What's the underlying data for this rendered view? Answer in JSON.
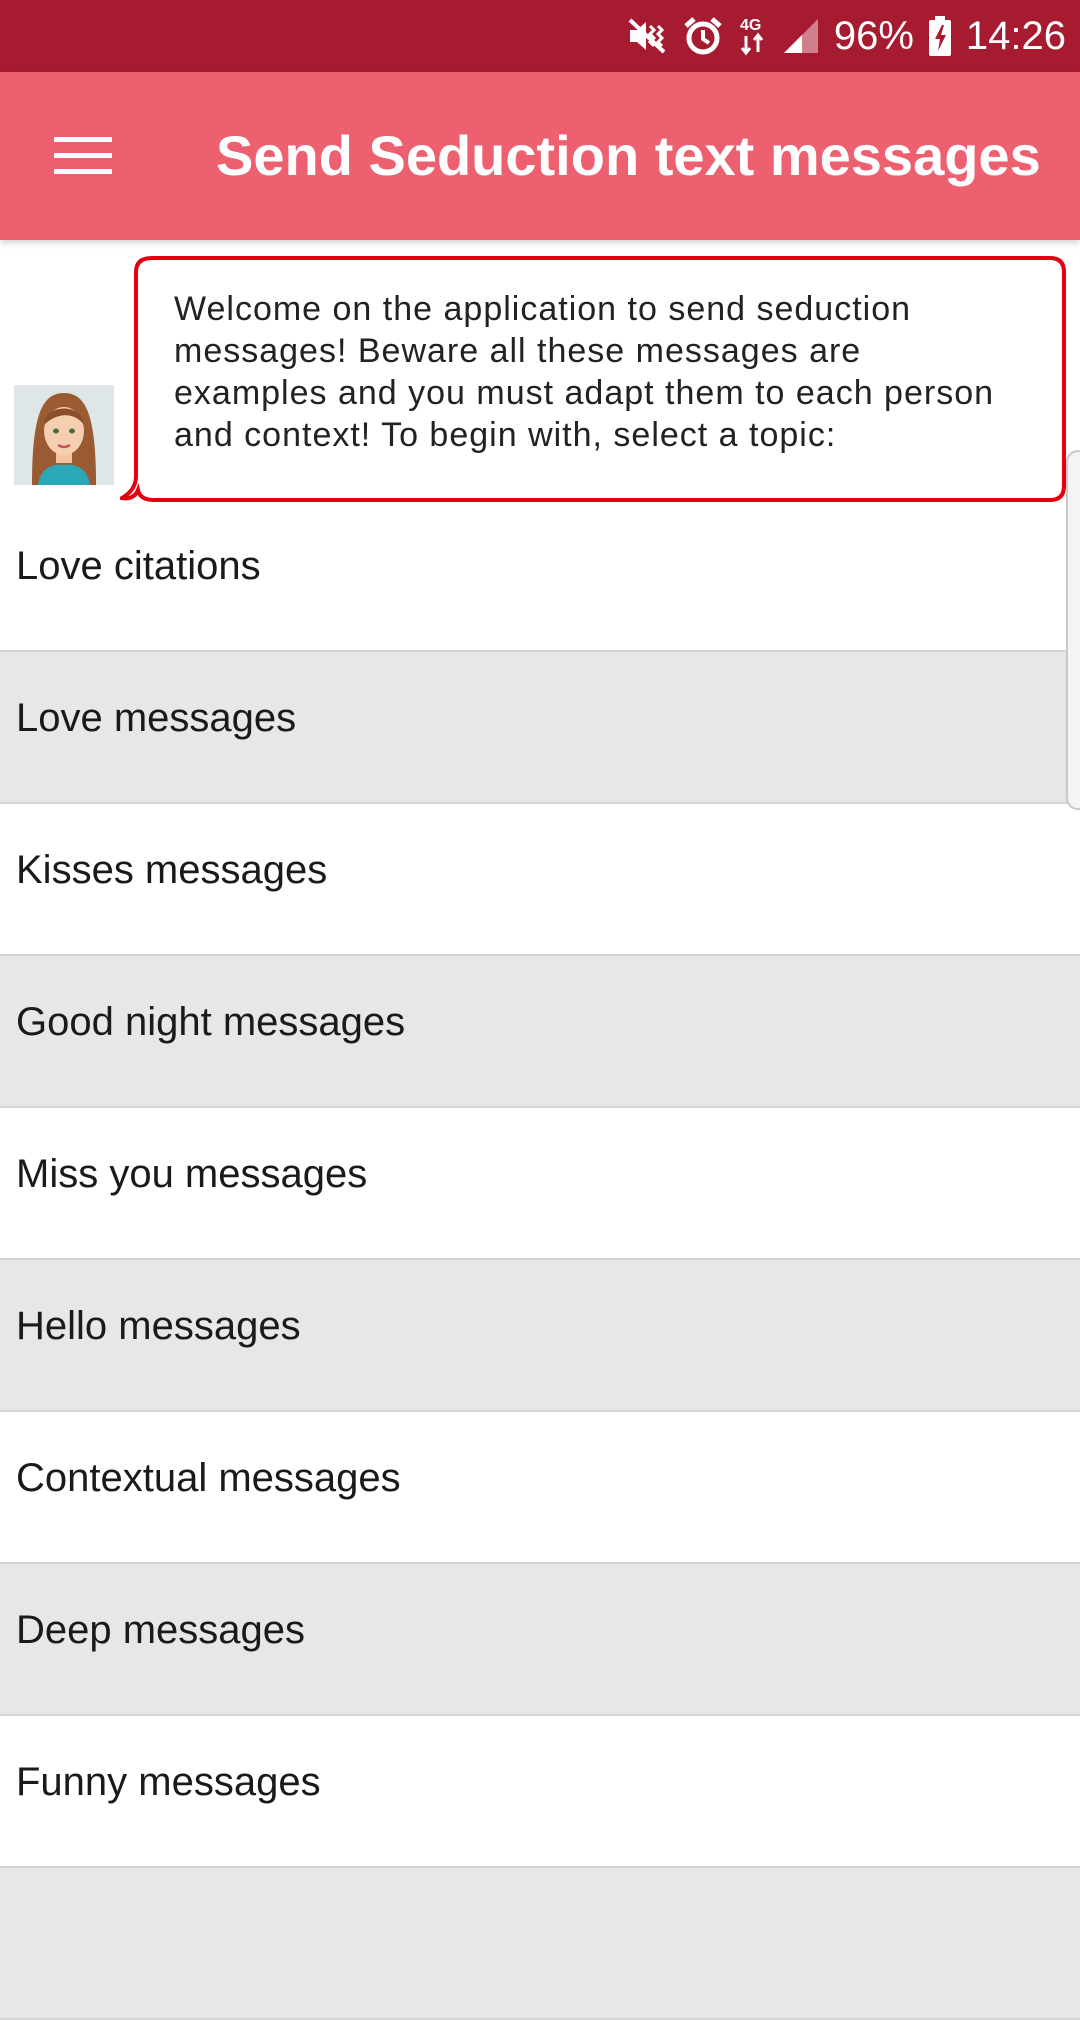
{
  "status_bar": {
    "battery": "96%",
    "time": "14:26",
    "network_type": "4G",
    "icons": [
      "mute-vibrate-icon",
      "alarm-icon",
      "data-arrows-icon",
      "signal-icon",
      "battery-charging-icon"
    ]
  },
  "app_bar": {
    "title": "Send Seduction text messages",
    "menu_icon": "hamburger-menu-icon"
  },
  "intro": {
    "message": "Welcome on the application to send seduction messages! Beware all these messages are examples and you must adapt them to each person and context! To begin with, select a topic:"
  },
  "topics": [
    {
      "label": "Love citations"
    },
    {
      "label": "Love messages"
    },
    {
      "label": "Kisses messages"
    },
    {
      "label": "Good night messages"
    },
    {
      "label": "Miss you messages"
    },
    {
      "label": "Hello messages"
    },
    {
      "label": "Contextual messages"
    },
    {
      "label": "Deep messages"
    },
    {
      "label": "Funny messages"
    }
  ],
  "colors": {
    "status_bar": "#a61b30",
    "app_bar": "#ed6070",
    "bubble_border": "#e3000f",
    "row_alt": "#e7e7e7"
  }
}
